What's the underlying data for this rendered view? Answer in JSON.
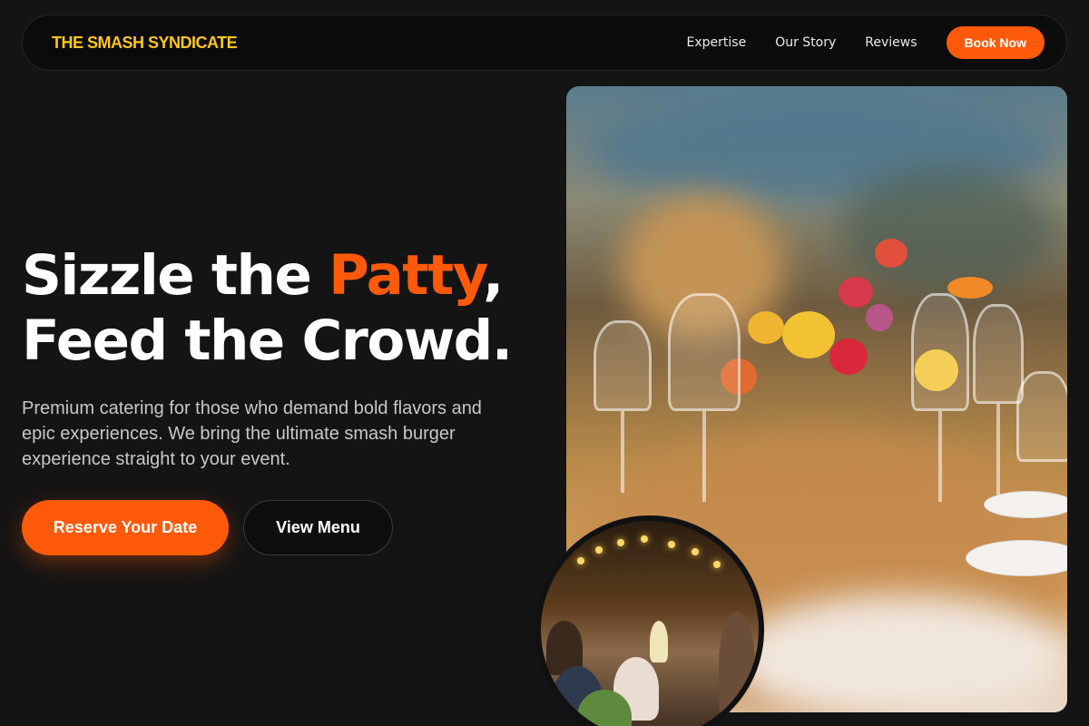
{
  "brand": {
    "logo_text": "THE SMASH SYNDICATE"
  },
  "nav": {
    "links": [
      "Expertise",
      "Our Story",
      "Reviews"
    ],
    "cta_label": "Book Now"
  },
  "hero": {
    "headline_part1": "Sizzle the ",
    "headline_accent": "Patty",
    "headline_part2": ",",
    "headline_line2": "Feed the Crowd.",
    "subtext": "Premium catering for those who demand bold flavors and epic experiences. We bring the ultimate smash burger experience straight to your event.",
    "primary_button": "Reserve Your Date",
    "secondary_button": "View Menu"
  },
  "images": {
    "main_photo": "banquet-table-photo",
    "circle_photo": "guests-toasting-photo"
  },
  "colors": {
    "accent": "#ff5a0a",
    "logo": "#ffc61c",
    "background": "#141414"
  }
}
